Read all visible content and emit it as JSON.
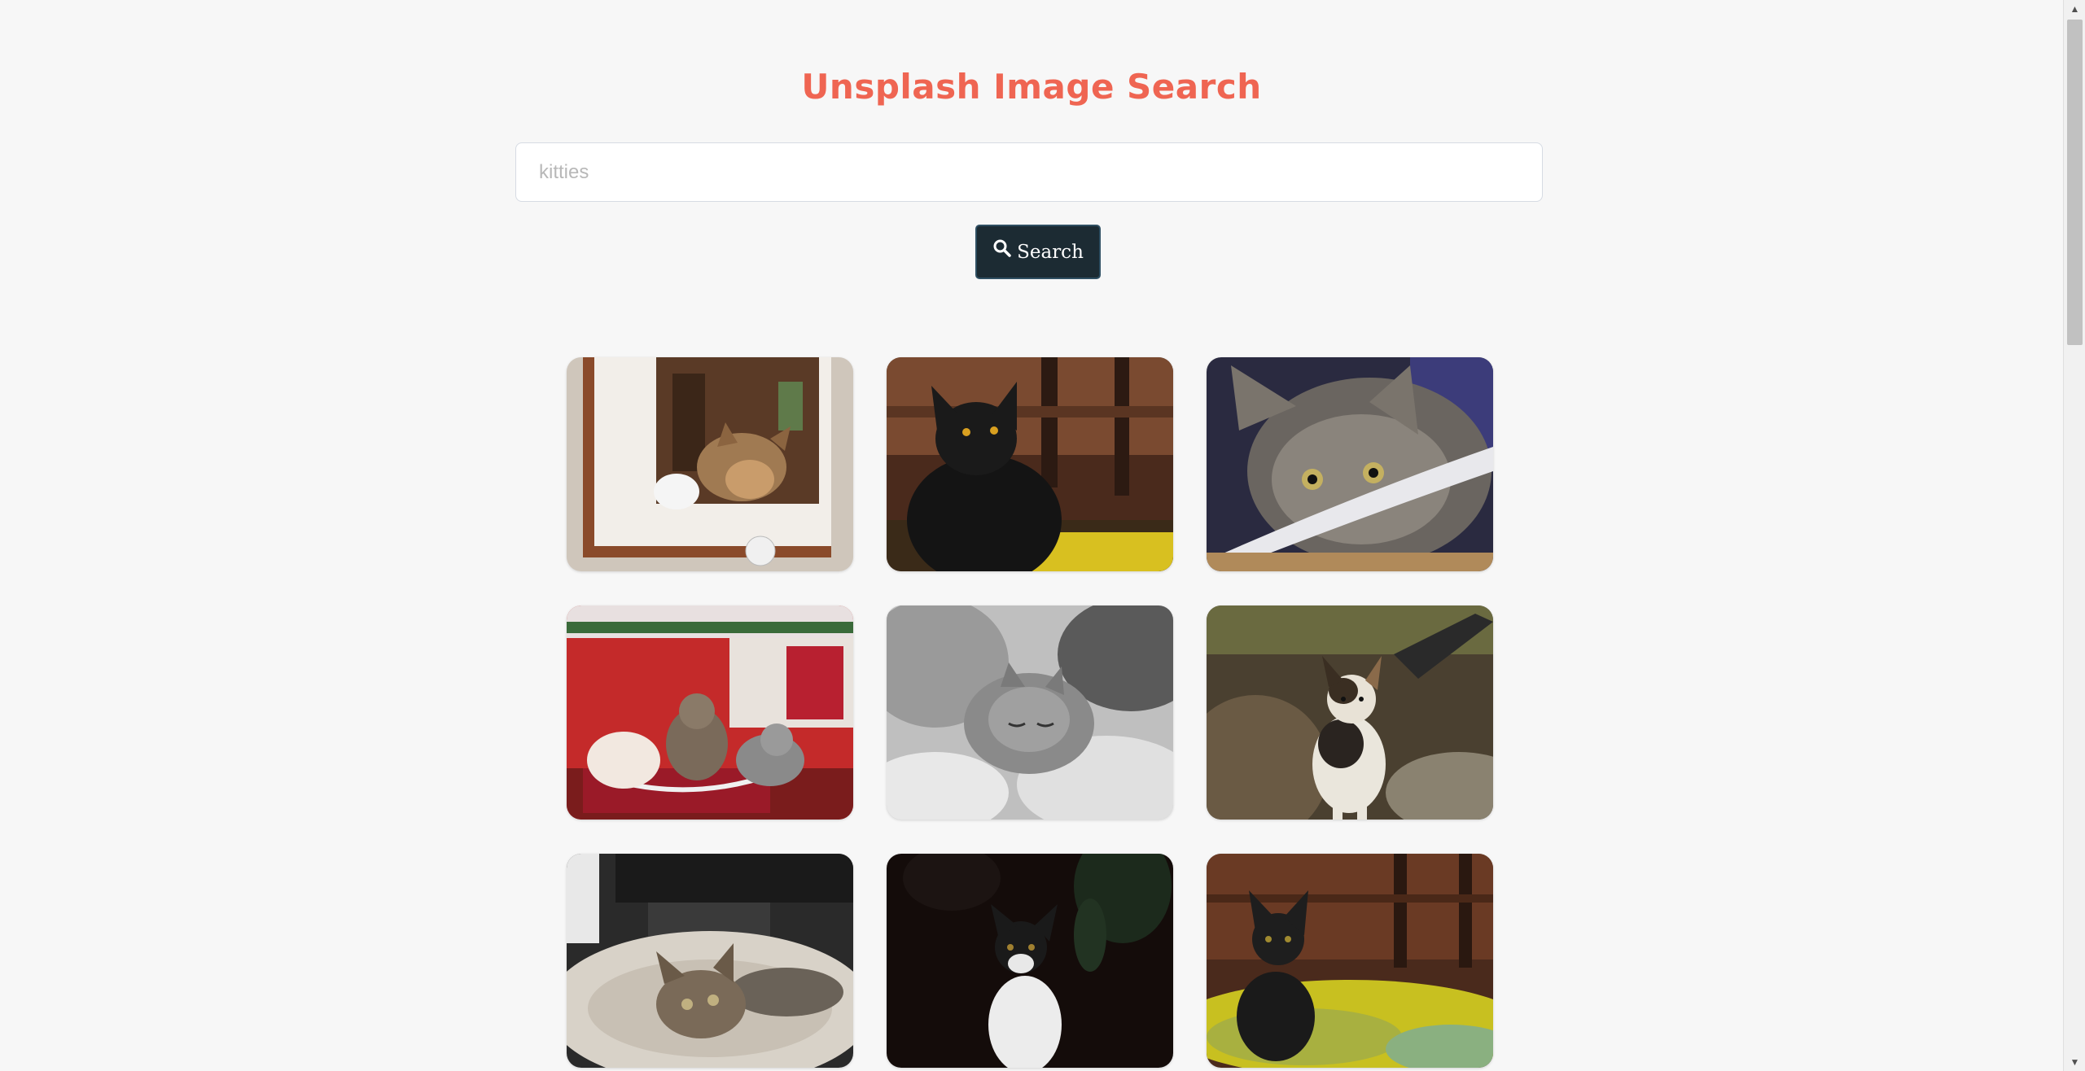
{
  "header": {
    "title": "Unsplash Image Search",
    "title_color": "#ef6552"
  },
  "search": {
    "placeholder": "kitties",
    "value": "",
    "button_label": "Search",
    "button_icon": "search-icon",
    "button_color": "#1c2b33"
  },
  "results": [
    {
      "subject": "tabby kitten in a white frame"
    },
    {
      "subject": "black kitten looking up"
    },
    {
      "subject": "tabby kitten in a bowl"
    },
    {
      "subject": "three cats on a red christmas bench"
    },
    {
      "subject": "sleeping cat in black and white"
    },
    {
      "subject": "calico kitten sitting"
    },
    {
      "subject": "tabby kitten in a cat bed"
    },
    {
      "subject": "black and white cat in the dark"
    },
    {
      "subject": "black kitten on a yellow blanket"
    }
  ],
  "scrollbar": {
    "up_icon": "triangle-up-icon",
    "down_icon": "triangle-down-icon"
  }
}
